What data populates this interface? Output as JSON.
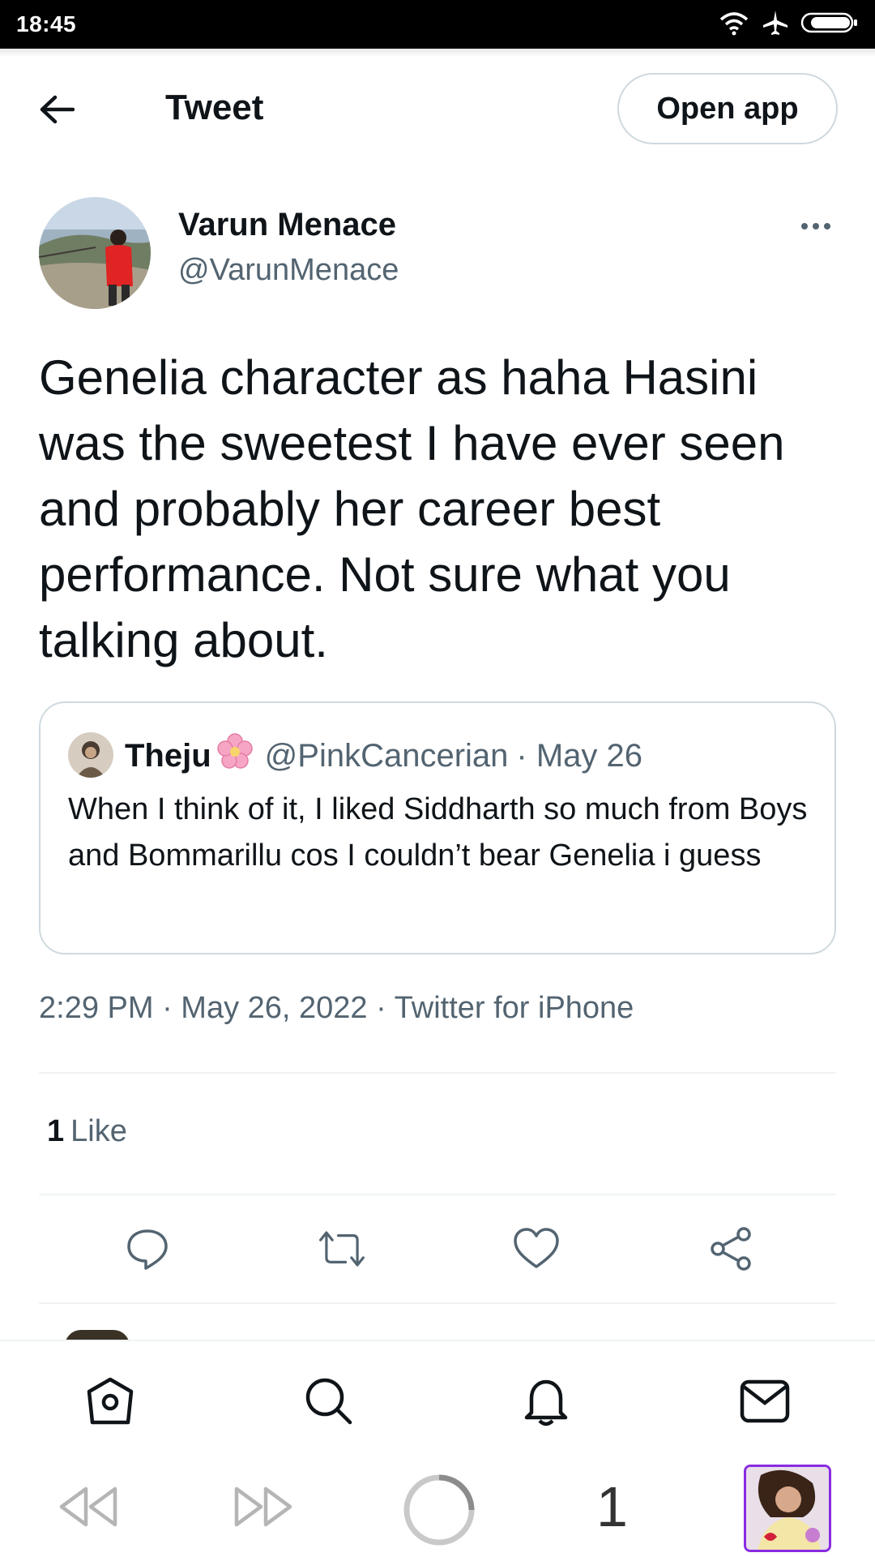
{
  "status_bar": {
    "time": "18:45"
  },
  "header": {
    "title": "Tweet",
    "open_app_label": "Open app"
  },
  "tweet": {
    "author_name": "Varun Menace",
    "author_handle": "@VarunMenace",
    "text": "Genelia character as haha Hasini was the sweetest I have ever seen and probably her career best performance. Not sure what you talking about.",
    "timestamp": "2:29 PM · May 26, 2022 · Twitter for iPhone",
    "likes_count": "1",
    "likes_label": "Like"
  },
  "quote": {
    "author_name": "Theju",
    "author_handle": "@PinkCancerian",
    "date": "· May 26",
    "text": "When I think of it, I liked Siddharth so much from Boys and Bommarillu cos I couldn’t bear Genelia i guess"
  },
  "browser": {
    "tab_count": "1"
  },
  "colors": {
    "text": "#0f1419",
    "secondary": "#536471",
    "border": "#cfd9de",
    "divider": "#eff3f4",
    "tab_outline": "#8a2be2"
  },
  "icons": [
    "wifi-icon",
    "airplane-icon",
    "battery-icon",
    "back-arrow-icon",
    "more-icon",
    "reply-icon",
    "retweet-icon",
    "like-icon",
    "share-icon",
    "home-icon",
    "search-icon",
    "notifications-icon",
    "messages-icon",
    "browser-back-icon",
    "browser-forward-icon",
    "reload-icon"
  ]
}
